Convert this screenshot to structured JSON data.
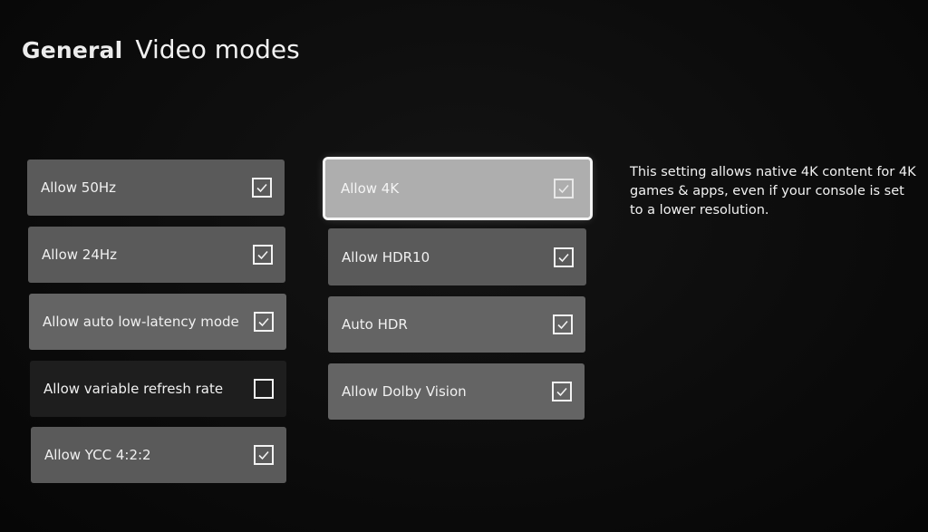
{
  "header": {
    "section": "General",
    "title": "Video modes"
  },
  "left_column": [
    {
      "label": "Allow 50Hz",
      "checked": true,
      "icon": "checkmark-icon"
    },
    {
      "label": "Allow 24Hz",
      "checked": true,
      "icon": "checkmark-icon"
    },
    {
      "label": "Allow auto low-latency mode",
      "checked": true,
      "icon": "checkmark-icon"
    },
    {
      "label": "Allow variable refresh rate",
      "checked": false,
      "icon": "empty-checkbox-icon"
    },
    {
      "label": "Allow YCC 4:2:2",
      "checked": true,
      "icon": "checkmark-icon"
    }
  ],
  "right_column": [
    {
      "label": "Allow 4K",
      "checked": true,
      "focused": true,
      "icon": "checkmark-icon"
    },
    {
      "label": "Allow HDR10",
      "checked": true,
      "icon": "checkmark-icon"
    },
    {
      "label": "Auto HDR",
      "checked": true,
      "icon": "checkmark-icon"
    },
    {
      "label": "Allow Dolby Vision",
      "checked": true,
      "icon": "checkmark-icon"
    }
  ],
  "description": "This setting allows native 4K content for 4K games & apps, even if your console is set to a lower resolution.",
  "colors": {
    "background": "#0b0b0b",
    "tile": "#525252",
    "tile_unchecked": "#1e1e1e",
    "tile_focused": "#aeaeae",
    "focus_outline": "#f4f4f4",
    "text": "#f2f2f2"
  }
}
